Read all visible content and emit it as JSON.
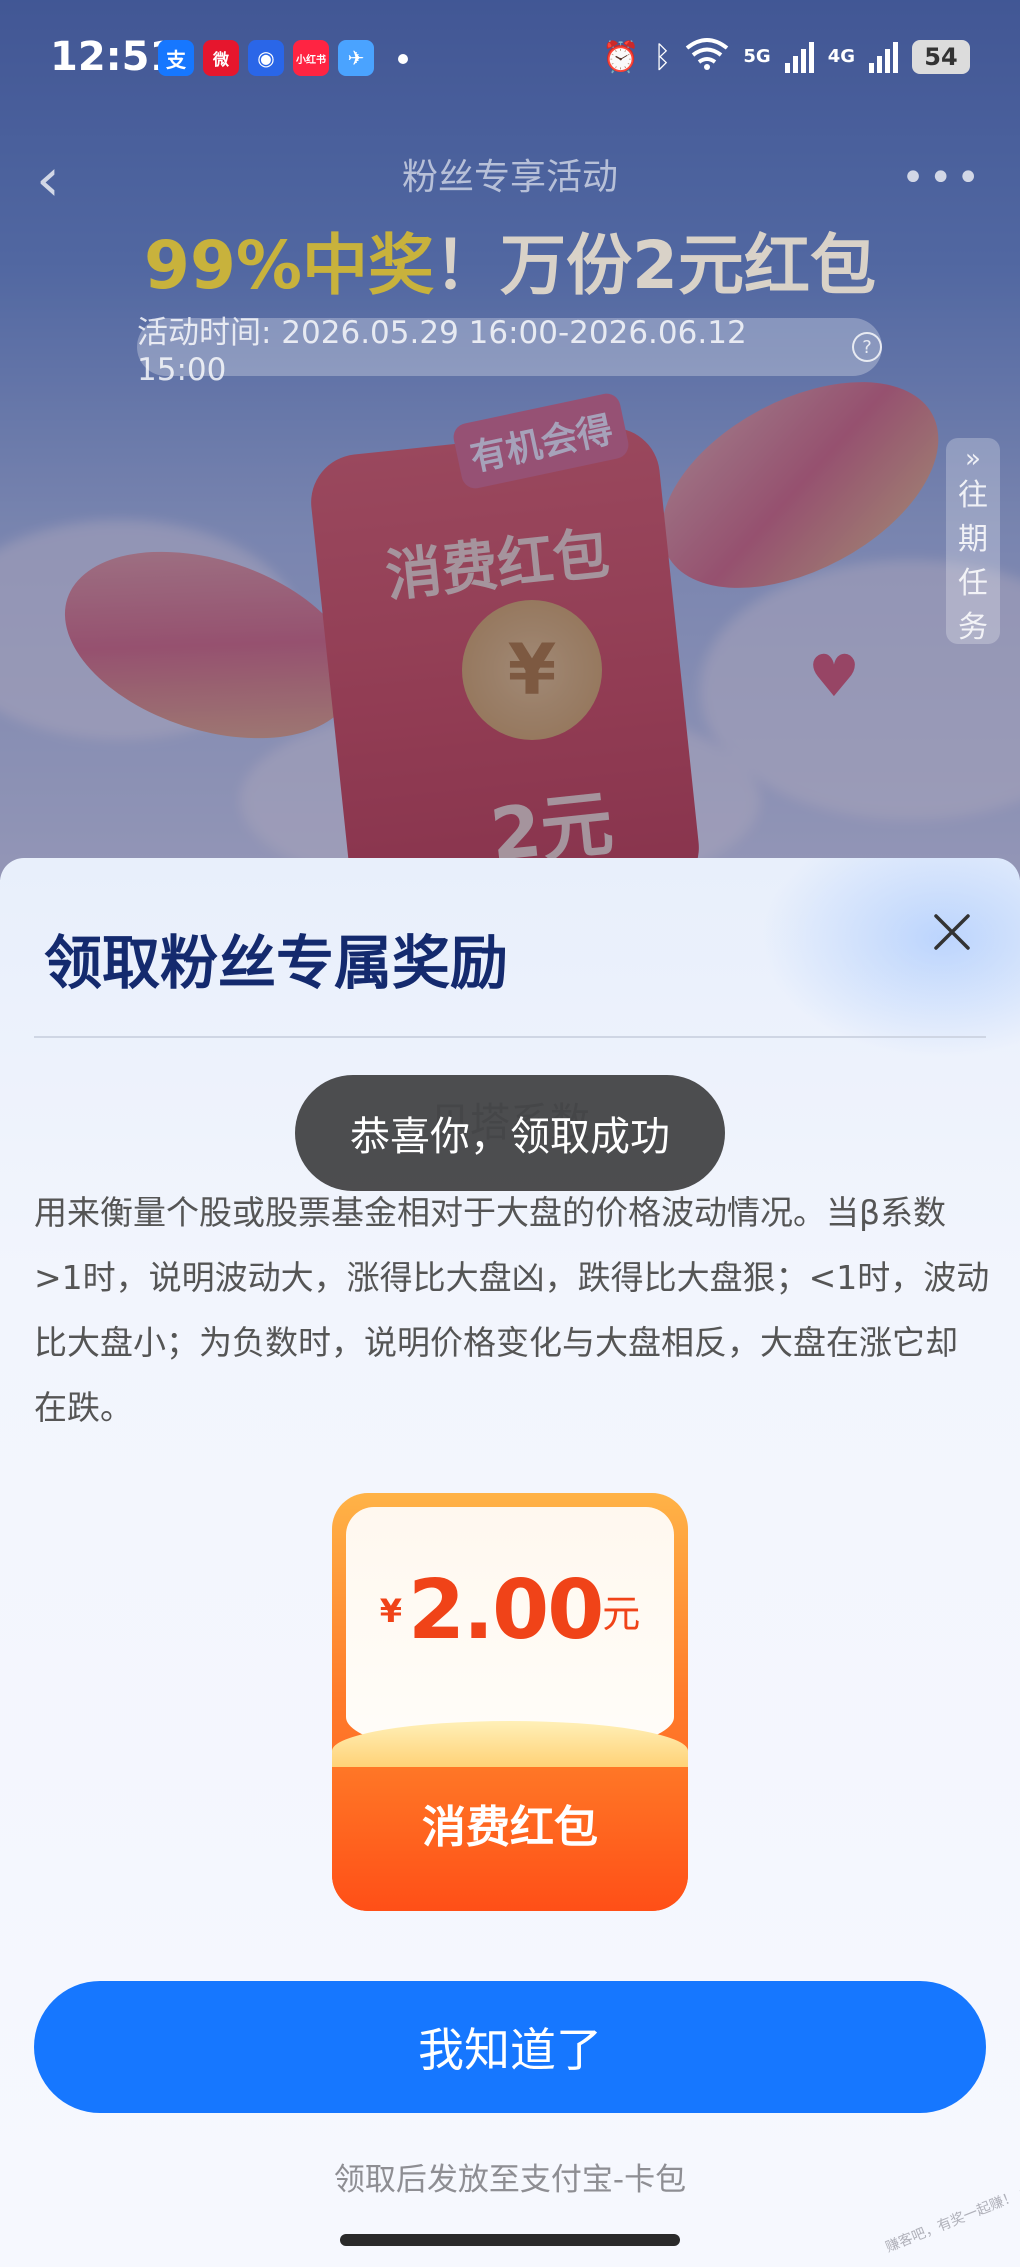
{
  "status_bar": {
    "time": "12:51",
    "apps": [
      {
        "name": "alipay-app-icon",
        "glyph": "支",
        "color": "#1677ff"
      },
      {
        "name": "weibo-app-icon",
        "glyph": "微",
        "color": "#e6162d"
      },
      {
        "name": "blue-circle-app-icon",
        "glyph": "◉",
        "color": "#2a66e8"
      },
      {
        "name": "xiaohongshu-app-icon",
        "glyph": "小红书",
        "color": "#ff2442"
      },
      {
        "name": "paper-plane-app-icon",
        "glyph": "✈",
        "color": "#4aa3ff"
      }
    ],
    "net_5g": "5G",
    "net_4g": "4G",
    "battery": "54"
  },
  "background": {
    "nav_title": "粉丝专享活动",
    "headline_highlight": "99%中奖",
    "headline_rest": "！万份2元红包",
    "activity_time": "活动时间: 2026.05.29 16:00-2026.06.12 15:00",
    "past_tasks": [
      "往",
      "期",
      "任",
      "务"
    ],
    "envelope_tag": "有机会得",
    "envelope_label": "消费红包",
    "envelope_amount": "2元",
    "coin_symbol": "¥"
  },
  "sheet": {
    "title": "领取粉丝专属奖励",
    "faded_heading": "贝塔系数",
    "description": "用来衡量个股或股票基金相对于大盘的价格波动情况。当β系数>1时，说明波动大，涨得比大盘凶，跌得比大盘狠；<1时，波动比大盘小；为负数时，说明价格变化与大盘相反，大盘在涨它却在跌。",
    "coupon": {
      "currency": "¥",
      "amount": "2.00",
      "unit": "元",
      "type": "消费红包"
    },
    "ok_button": "我知道了",
    "footnote": "领取后发放至支付宝-卡包"
  },
  "toast": "恭喜你，领取成功",
  "watermark": "赚客吧，有奖一起赚！ www.zuanke8.com",
  "colors": {
    "primary_button": "#1677ff",
    "sheet_title": "#142a6e",
    "coupon_amount": "#f04318"
  }
}
